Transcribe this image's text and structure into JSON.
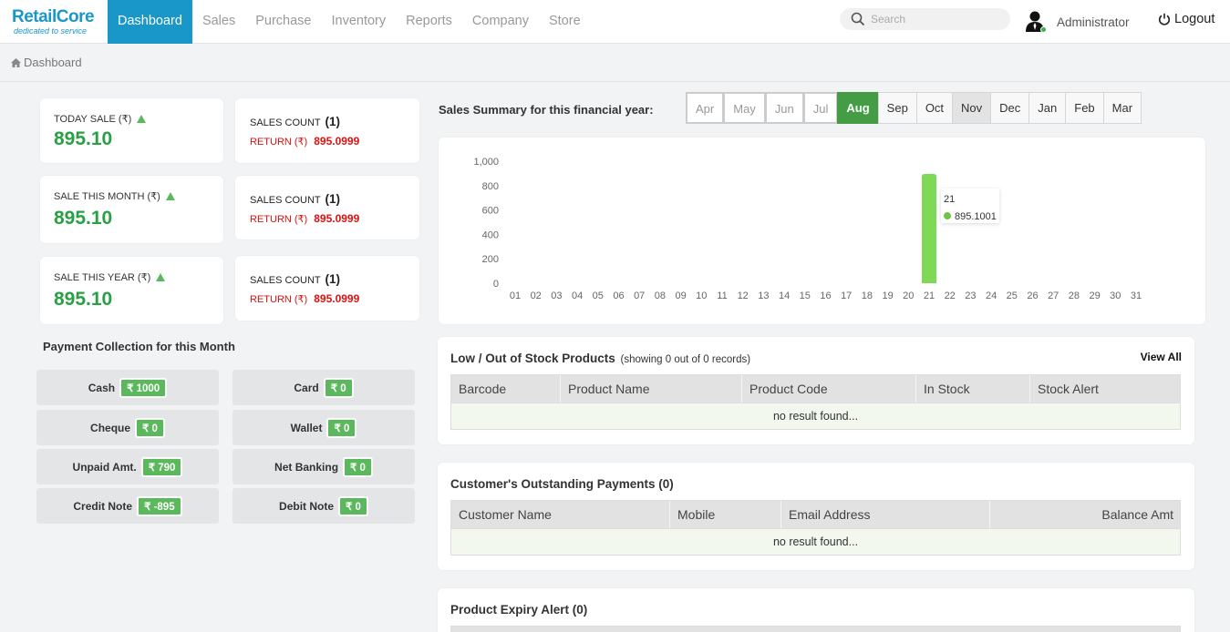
{
  "brand": {
    "name": "RetailCore",
    "tagline": "dedicated to service"
  },
  "nav": [
    {
      "label": "Dashboard",
      "active": true
    },
    {
      "label": "Sales"
    },
    {
      "label": "Purchase"
    },
    {
      "label": "Inventory"
    },
    {
      "label": "Reports"
    },
    {
      "label": "Company"
    },
    {
      "label": "Store"
    }
  ],
  "search": {
    "placeholder": "Search"
  },
  "user": {
    "name": "Administrator"
  },
  "logout_label": "Logout",
  "breadcrumb": "Dashboard",
  "stats": [
    {
      "label": "TODAY SALE (₹)",
      "value": "895.10",
      "count_label": "SALES COUNT",
      "count": "(1)",
      "return_label": "RETURN (₹)",
      "return_value": "895.0999"
    },
    {
      "label": "SALE THIS MONTH (₹)",
      "value": "895.10",
      "count_label": "SALES COUNT",
      "count": "(1)",
      "return_label": "RETURN (₹)",
      "return_value": "895.0999"
    },
    {
      "label": "SALE THIS YEAR (₹)",
      "value": "895.10",
      "count_label": "SALES COUNT",
      "count": "(1)",
      "return_label": "RETURN (₹)",
      "return_value": "895.0999"
    }
  ],
  "payment": {
    "title": "Payment Collection for this Month",
    "items": [
      {
        "name": "Cash",
        "amount": "₹ 1000"
      },
      {
        "name": "Card",
        "amount": "₹ 0"
      },
      {
        "name": "Cheque",
        "amount": "₹ 0"
      },
      {
        "name": "Wallet",
        "amount": "₹ 0"
      },
      {
        "name": "Unpaid Amt.",
        "amount": "₹ 790"
      },
      {
        "name": "Net Banking",
        "amount": "₹ 0"
      },
      {
        "name": "Credit Note",
        "amount": "₹ -895"
      },
      {
        "name": "Debit Note",
        "amount": "₹ 0"
      }
    ]
  },
  "summary": {
    "title": "Sales Summary for this financial year:",
    "months": [
      "Apr",
      "May",
      "Jun",
      "Jul",
      "Aug",
      "Sep",
      "Oct",
      "Nov",
      "Dec",
      "Jan",
      "Feb",
      "Mar"
    ],
    "selected": "Aug"
  },
  "chart_data": {
    "type": "bar",
    "categories": [
      "01",
      "02",
      "03",
      "04",
      "05",
      "06",
      "07",
      "08",
      "09",
      "10",
      "11",
      "12",
      "13",
      "14",
      "15",
      "16",
      "17",
      "18",
      "19",
      "20",
      "21",
      "22",
      "23",
      "24",
      "25",
      "26",
      "27",
      "28",
      "29",
      "30",
      "31"
    ],
    "values": [
      0,
      0,
      0,
      0,
      0,
      0,
      0,
      0,
      0,
      0,
      0,
      0,
      0,
      0,
      0,
      0,
      0,
      0,
      0,
      0,
      895.1001,
      0,
      0,
      0,
      0,
      0,
      0,
      0,
      0,
      0,
      0
    ],
    "ylim": [
      0,
      1000
    ],
    "yticks": [
      "0",
      "200",
      "400",
      "600",
      "800",
      "1,000"
    ],
    "bar_color": "#7ed957",
    "tooltip": {
      "label": "21",
      "value": "895.1001"
    },
    "grid": false
  },
  "low_stock": {
    "title": "Low / Out of Stock Products",
    "subtitle": "(showing 0 out of 0 records)",
    "view_all": "View All",
    "columns": [
      "Barcode",
      "Product Name",
      "Product Code",
      "In Stock",
      "Stock Alert"
    ],
    "empty": "no result found..."
  },
  "outstanding": {
    "title": "Customer's Outstanding Payments (0)",
    "columns": [
      "Customer Name",
      "Mobile",
      "Email Address",
      "Balance Amt"
    ],
    "empty": "no result found..."
  },
  "expiry": {
    "title": "Product Expiry Alert (0)"
  },
  "colors": {
    "primary": "#1a97c9",
    "green": "#29a046",
    "red": "#dd1111",
    "accent_green": "#5cb85c"
  }
}
